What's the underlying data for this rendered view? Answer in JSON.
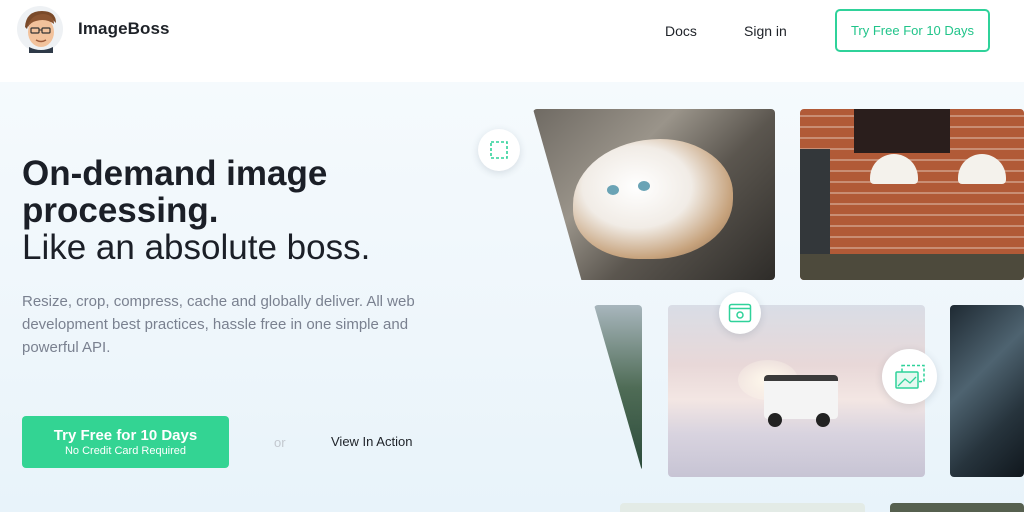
{
  "header": {
    "brand": "ImageBoss",
    "nav": {
      "docs": "Docs",
      "sign_in": "Sign in"
    },
    "cta": "Try Free For 10 Days"
  },
  "hero": {
    "title_strong": "On-demand image processing.",
    "title_light": "Like an absolute boss.",
    "description": "Resize, crop, compress, cache and globally deliver. All web development best practices, hassle free in one simple and powerful API.",
    "primary_button": {
      "label": "Try Free for 10 Days",
      "sublabel": "No Credit Card Required"
    },
    "or_text": "or",
    "secondary_link": "View In Action"
  },
  "icons": {
    "logo": "avatar-logo-icon",
    "bubble1": "crop-icon",
    "bubble2": "browser-settings-icon",
    "bubble3": "image-resize-icon"
  },
  "colors": {
    "accent": "#33d493",
    "accent_text": "#21c48a",
    "text": "#1b1f27",
    "muted": "#7a8190"
  }
}
